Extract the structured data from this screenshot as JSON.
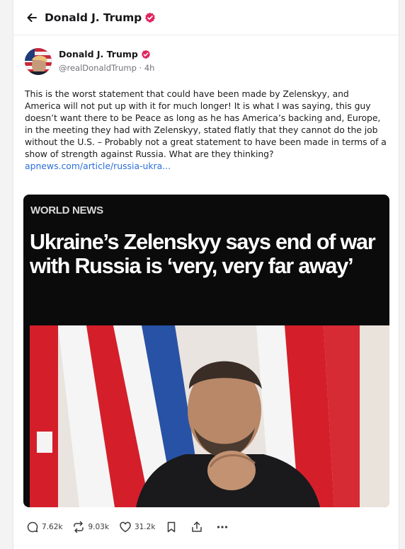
{
  "header": {
    "title": "Donald J. Trump"
  },
  "post": {
    "author_name": "Donald J. Trump",
    "handle": "@realDonaldTrump",
    "separator": "·",
    "age": "4h",
    "text": "This is the worst statement that could have been made by Zelenskyy, and America will not put up with it for much longer! It is what I was saying, this guy doesn’t want there to be Peace as long as he has America’s backing and, Europe, in the meeting they had with Zelenskyy, stated flatly that they cannot do the job without the U.S. – Probably not a great statement to have been made in terms of a show of strength against Russia. What are they thinking?",
    "link_text": "apnews.com/article/russia-ukra..."
  },
  "card": {
    "kicker": "WORLD NEWS",
    "headline": "Ukraine’s Zelenskyy says end of war with Russia is ‘very, very far away’"
  },
  "actions": {
    "replies": "7.62k",
    "reposts": "9.03k",
    "likes": "31.2k"
  },
  "colors": {
    "verified_badge": "#e0245e",
    "link": "#2a6fdb",
    "flag_red": "#d41f2b",
    "flag_blue": "#2852a5"
  }
}
